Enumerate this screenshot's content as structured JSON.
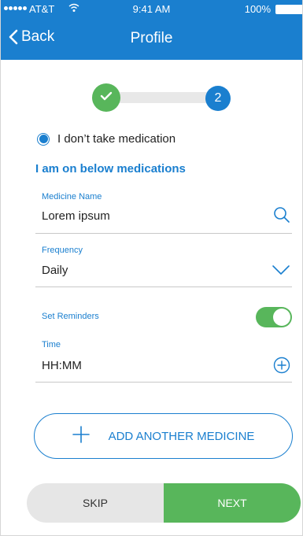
{
  "status_bar": {
    "carrier": "AT&T",
    "time": "9:41 AM",
    "battery": "100%"
  },
  "nav": {
    "back_label": "Back",
    "title": "Profile"
  },
  "stepper": {
    "completed_icon": "check-icon",
    "current_step": "2"
  },
  "medication": {
    "no_med_label": "I don’t take medication",
    "no_med_selected": true,
    "section_heading": "I am on below medications"
  },
  "fields": {
    "medicine_name": {
      "label": "Medicine Name",
      "value": "Lorem ipsum",
      "icon": "search-icon"
    },
    "frequency": {
      "label": "Frequency",
      "value": "Daily",
      "icon": "chevron-down-icon"
    },
    "reminders": {
      "label": "Set Reminders",
      "enabled": true
    },
    "time": {
      "label": "Time",
      "value": "HH:MM",
      "icon": "plus-circle-icon"
    }
  },
  "add_medicine_label": "ADD ANOTHER MEDICINE",
  "footer": {
    "skip_label": "SKIP",
    "next_label": "NEXT"
  },
  "colors": {
    "primary": "#1a7fcf",
    "success": "#58b65b",
    "muted": "#e6e6e6"
  }
}
